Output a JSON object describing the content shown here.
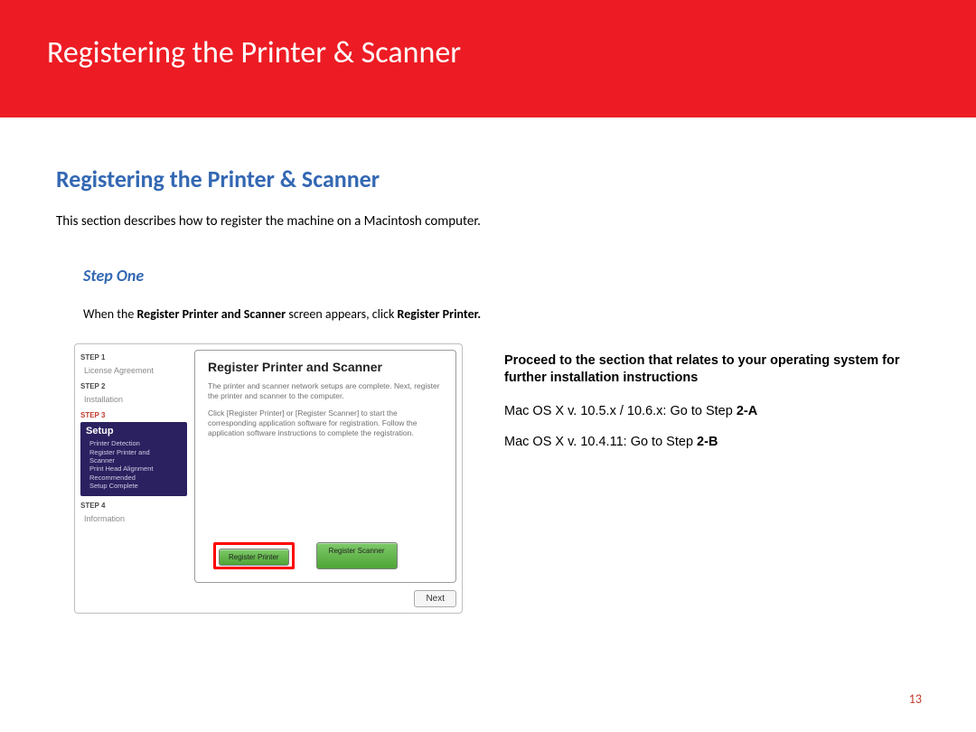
{
  "header": {
    "title": "Registering the Printer & Scanner"
  },
  "section": {
    "heading": "Registering the  Printer & Scanner",
    "description": "This section describes how to register the machine on a Macintosh computer."
  },
  "step": {
    "label": "Step One",
    "instr_prefix": "When the ",
    "instr_bold1": "Register Printer and Scanner",
    "instr_mid": " screen appears, click ",
    "instr_bold2": "Register Printer."
  },
  "screenshot": {
    "sidebar": {
      "step1_label": "STEP 1",
      "step1_item": "License Agreement",
      "step2_label": "STEP 2",
      "step2_item": "Installation",
      "step3_label": "STEP 3",
      "setup_title": "Setup",
      "setup_items": [
        "Printer Detection",
        "Register Printer and",
        "Scanner",
        "Print Head Alignment",
        "Recommended",
        "Setup Complete"
      ],
      "step4_label": "STEP 4",
      "step4_item": "Information"
    },
    "panel": {
      "title": "Register Printer and Scanner",
      "para1": "The printer and scanner network setups are complete. Next, register the printer and scanner to the computer.",
      "para2": "Click [Register Printer] or [Register Scanner] to start the corresponding application software for registration. Follow the application software instructions to complete the registration.",
      "btn_register_printer": "Register Printer",
      "btn_register_scanner": "Register Scanner",
      "btn_next": "Next"
    }
  },
  "right": {
    "bold_line": "Proceed to the section that relates to your operating system for further installation instructions",
    "os1_prefix": "Mac OS X v. 10.5.x / 10.6.x: Go to Step ",
    "os1_bold": "2-A",
    "os2_prefix": "Mac OS X v. 10.4.11: Go to Step ",
    "os2_bold": "2-B"
  },
  "page_number": "13"
}
